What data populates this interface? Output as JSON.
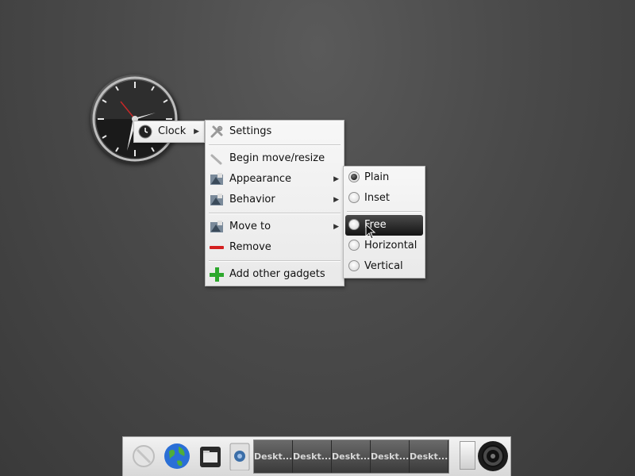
{
  "clock_menu": {
    "label": "Clock",
    "icon": "clock-icon"
  },
  "gadget_menu": {
    "settings": "Settings",
    "begin_move": "Begin move/resize",
    "appearance": "Appearance",
    "behavior": "Behavior",
    "move_to": "Move to",
    "remove": "Remove",
    "add_gadgets": "Add other gadgets"
  },
  "appearance_menu": {
    "items": [
      {
        "label": "Plain",
        "checked": true
      },
      {
        "label": "Inset",
        "checked": false
      },
      {
        "label": "Free",
        "checked": false,
        "highlighted": true
      },
      {
        "label": "Horizontal",
        "checked": false
      },
      {
        "label": "Vertical",
        "checked": false
      }
    ]
  },
  "shelf": {
    "desktops": [
      "Deskt...",
      "Deskt...",
      "Deskt...",
      "Deskt...",
      "Deskt..."
    ],
    "icons": [
      "start-icon",
      "globe-icon",
      "file-manager-icon",
      "gadget-icon",
      "screensaver-icon"
    ]
  },
  "colors": {
    "background": "#4a4a4a",
    "menu_bg": "#f0f0f0",
    "highlight_bg": "#1e1e1e",
    "highlight_fg": "#ffffff"
  }
}
